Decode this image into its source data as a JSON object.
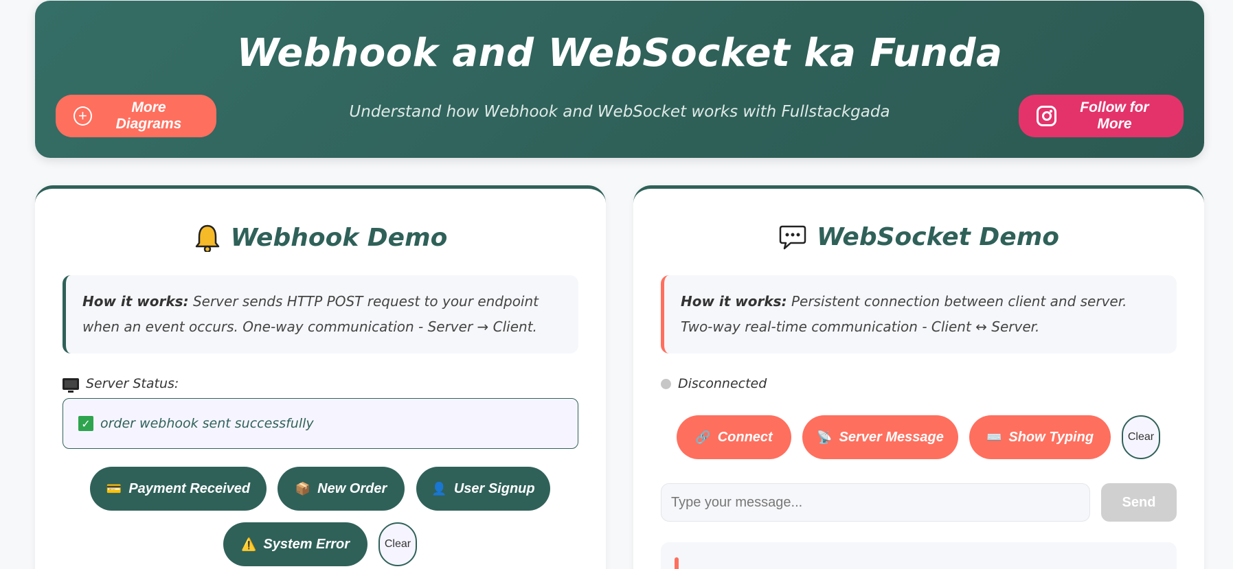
{
  "header": {
    "title": "Webhook and WebSocket ka Funda",
    "subtitle": "Understand how Webhook and WebSocket works with Fullstackgada",
    "more_label": "More Diagrams",
    "follow_label": "Follow for More"
  },
  "webhook": {
    "title": "Webhook Demo",
    "info_label": "How it works:",
    "info_text": " Server sends HTTP POST request to your endpoint when an event occurs. One-way communication - Server → Client.",
    "status_label": "Server Status:",
    "status_value": "order webhook sent successfully",
    "buttons": {
      "payment": "Payment Received",
      "order": "New Order",
      "signup": "User Signup",
      "error": "System Error",
      "clear": "Clear"
    }
  },
  "websocket": {
    "title": "WebSocket Demo",
    "info_label": "How it works:",
    "info_text": " Persistent connection between client and server. Two-way real-time communication - Client ↔ Server.",
    "status": "Disconnected",
    "buttons": {
      "connect": "Connect",
      "server_message": "Server Message",
      "show_typing": "Show Typing",
      "clear": "Clear"
    },
    "input_placeholder": "Type your message...",
    "send_label": "Send"
  }
}
